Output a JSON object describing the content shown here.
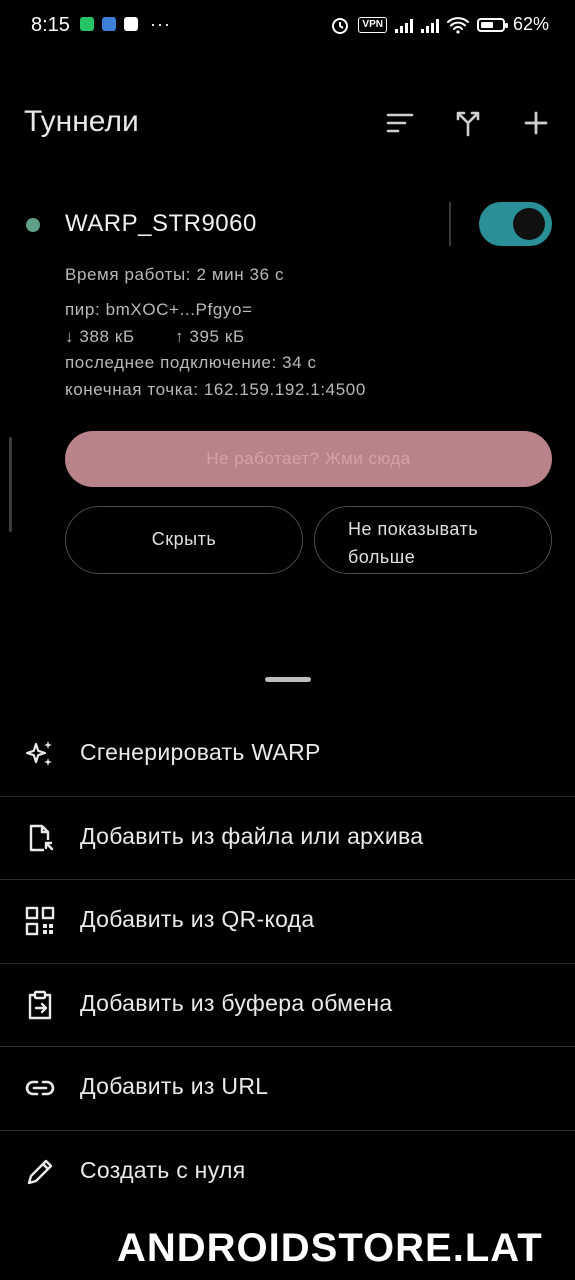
{
  "status_bar": {
    "time": "8:15",
    "vpn_label": "VPN",
    "battery_text": "62%",
    "battery_level": 0.62,
    "notification_icons": [
      "whatsapp-icon",
      "app-icon",
      "edit-icon"
    ],
    "more_glyph": "···"
  },
  "header": {
    "title": "Туннели",
    "actions": [
      "sort-icon",
      "split-tunnel-icon",
      "add-icon"
    ]
  },
  "tunnel": {
    "name": "WARP_STR9060",
    "enabled": true,
    "status_color": "#5fa088",
    "toggle_color": "#2a8f96",
    "uptime": "Время работы: 2 мин 36 с",
    "peer": "пир: bmXOC+...Pfgyo=",
    "rx": "↓ 388 кБ",
    "tx": "↑ 395 кБ",
    "last_handshake": "последнее подключение: 34 с",
    "endpoint": "конечная точка: 162.159.192.1:4500"
  },
  "prompt": {
    "main_button": "Не работает? Жми сюда",
    "hide_button": "Скрыть",
    "never_line1": "Не показывать",
    "never_line2": "больше"
  },
  "sheet": {
    "items": [
      {
        "label": "Сгенерировать WARP",
        "icon": "sparkle-icon"
      },
      {
        "label": "Добавить из файла или архива",
        "icon": "file-import-icon"
      },
      {
        "label": "Добавить из QR-кода",
        "icon": "qr-code-icon"
      },
      {
        "label": "Добавить из буфера обмена",
        "icon": "clipboard-icon"
      },
      {
        "label": "Добавить из URL",
        "icon": "link-icon"
      },
      {
        "label": "Создать с нуля",
        "icon": "pencil-icon"
      }
    ]
  },
  "watermark": "ANDROIDSTORE.LAT"
}
